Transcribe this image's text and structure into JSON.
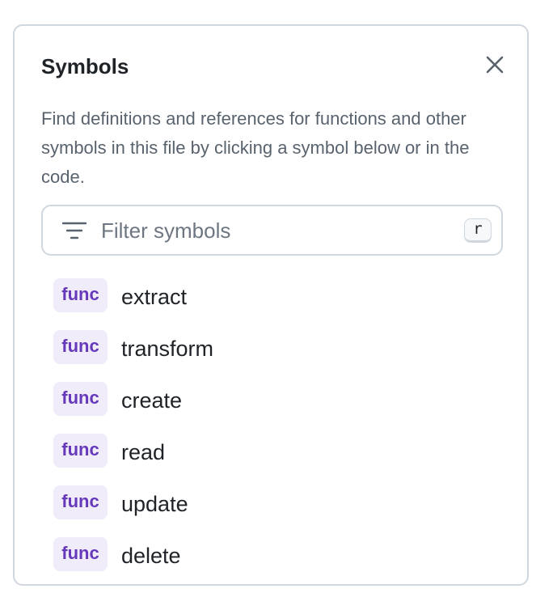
{
  "panel": {
    "title": "Symbols",
    "close_icon": "close-icon",
    "description": "Find definitions and references for functions and other symbols in this file by clicking a symbol below or in the code."
  },
  "filter": {
    "icon": "filter-icon",
    "placeholder": "Filter symbols",
    "value": "",
    "shortcut": "r"
  },
  "symbols": [
    {
      "kind": "func",
      "name": "extract"
    },
    {
      "kind": "func",
      "name": "transform"
    },
    {
      "kind": "func",
      "name": "create"
    },
    {
      "kind": "func",
      "name": "read"
    },
    {
      "kind": "func",
      "name": "update"
    },
    {
      "kind": "func",
      "name": "delete"
    }
  ],
  "colors": {
    "badge_text": "#6639ba",
    "badge_bg": "#f0ecfa",
    "border": "#d0d7de",
    "muted_text": "#59636e"
  }
}
